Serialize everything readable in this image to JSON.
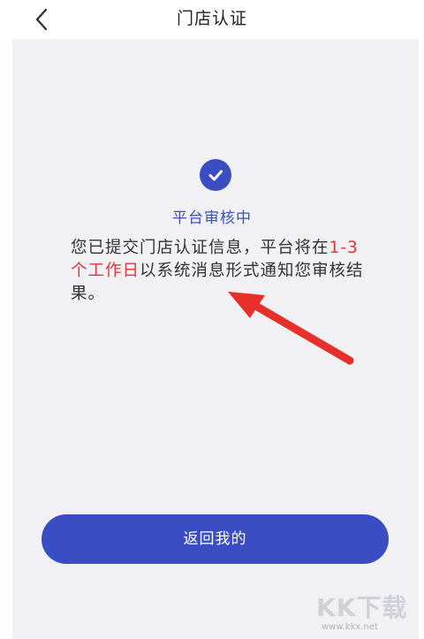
{
  "header": {
    "title": "门店认证",
    "back_icon": "chevron-left-icon"
  },
  "status": {
    "icon": "check-circle-icon",
    "text": "平台审核中"
  },
  "message": {
    "part1": "您已提交门店认证信息，平台将在",
    "highlight": "1-3个工作日",
    "part2": "以系统消息形式通知您审核结果。"
  },
  "button": {
    "label": "返回我的"
  },
  "watermark": {
    "logo": "KK下载",
    "url": "www.kkx.net"
  },
  "colors": {
    "accent": "#3a4dc2",
    "highlight": "#e8333c",
    "panel_bg": "#f1f1f4",
    "annotation_arrow": "#e8302a"
  }
}
